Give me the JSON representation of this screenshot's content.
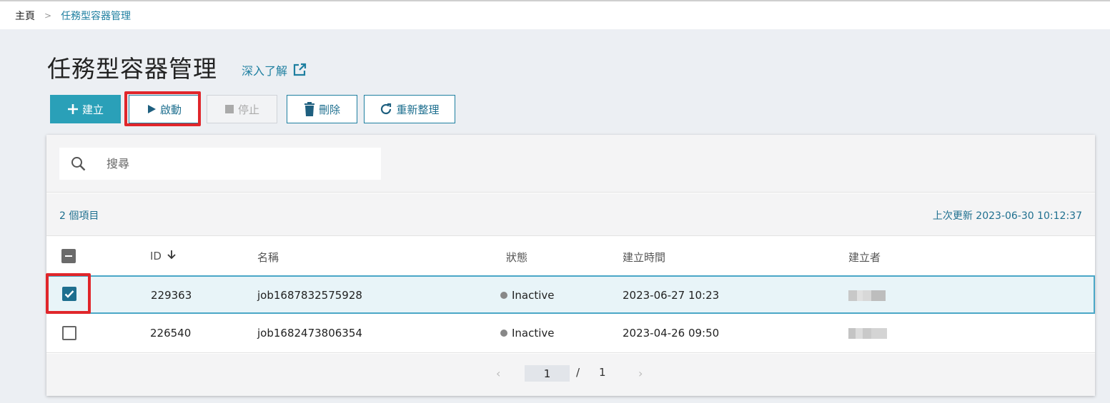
{
  "breadcrumb": {
    "home": "主頁",
    "separator": ">",
    "current": "任務型容器管理"
  },
  "header": {
    "title": "任務型容器管理",
    "learn_more": "深入了解"
  },
  "toolbar": {
    "create_label": "建立",
    "start_label": "啟動",
    "stop_label": "停止",
    "delete_label": "刪除",
    "refresh_label": "重新整理"
  },
  "search": {
    "placeholder": "搜尋"
  },
  "summary": {
    "item_count": "2 個項目",
    "last_update": "上次更新 2023-06-30 10:12:37"
  },
  "table": {
    "columns": {
      "id": "ID",
      "name": "名稱",
      "status": "狀態",
      "created_at": "建立時間",
      "creator": "建立者"
    },
    "rows": [
      {
        "id": "229363",
        "name": "job1687832575928",
        "status": "Inactive",
        "created_at": "2023-06-27 10:23",
        "selected": true
      },
      {
        "id": "226540",
        "name": "job1682473806354",
        "status": "Inactive",
        "created_at": "2023-04-26 09:50",
        "selected": false
      }
    ]
  },
  "pagination": {
    "current": "1",
    "separator": "/",
    "total": "1",
    "prev": "‹",
    "next": "›"
  },
  "colors": {
    "accent": "#2aa0b8",
    "link": "#1e7fa0",
    "highlight": "#e0262b",
    "status_inactive": "#888888"
  }
}
